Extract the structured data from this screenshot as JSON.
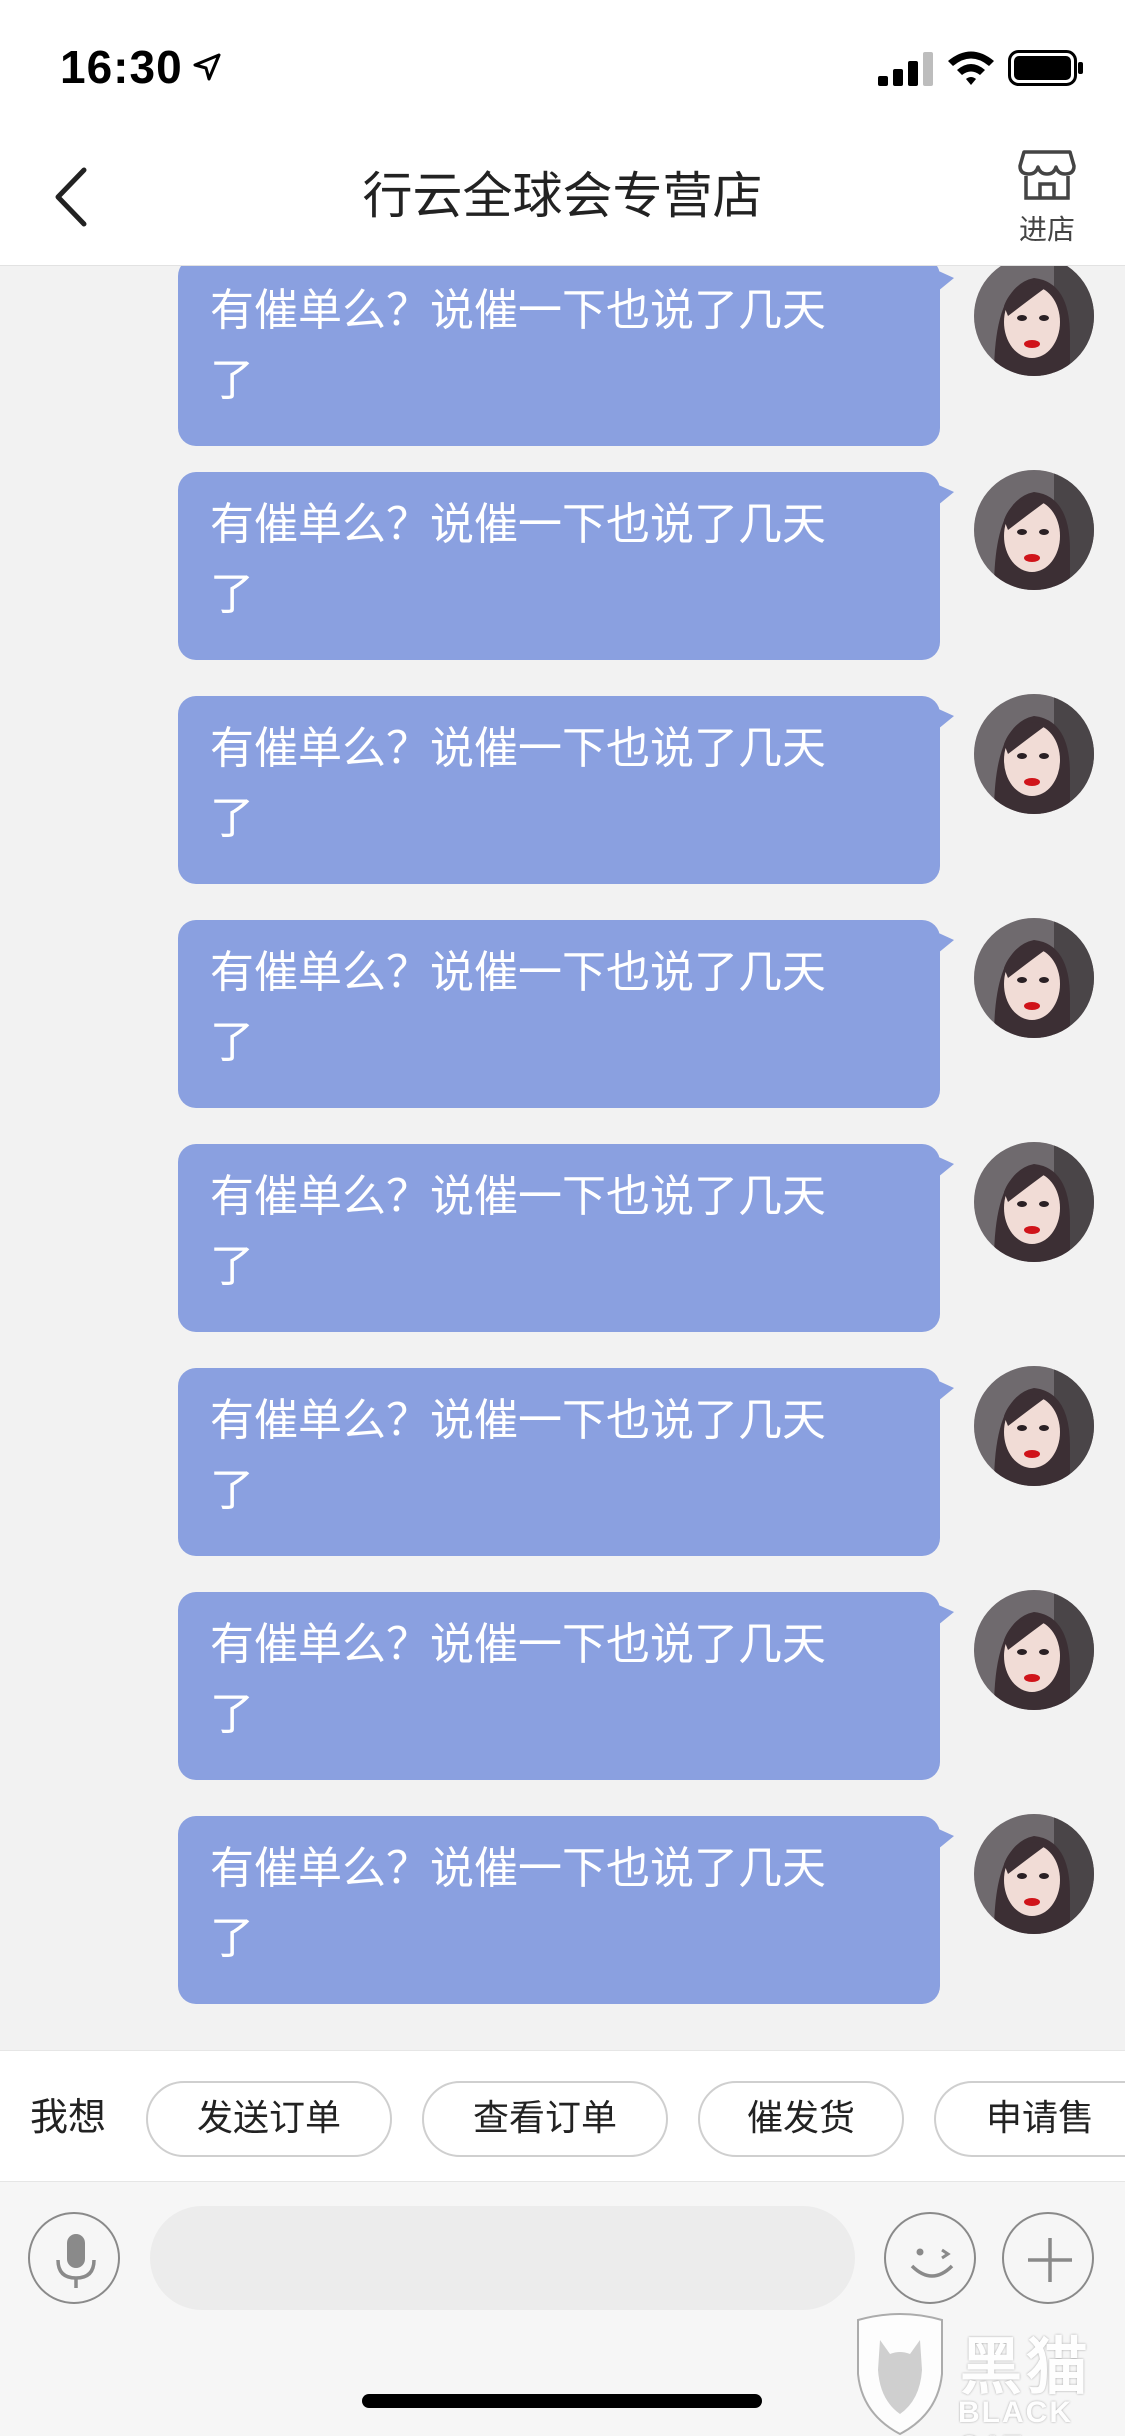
{
  "status_bar": {
    "time": "16:30",
    "icons": [
      "location-arrow-icon",
      "cellular-signal-icon",
      "wifi-icon",
      "battery-icon"
    ]
  },
  "nav": {
    "back_icon": "chevron-left-icon",
    "title": "行云全球会专营店",
    "store_icon": "storefront-icon",
    "store_label": "进店"
  },
  "messages": [
    {
      "line1": "有催单么？说催一下也说了几天",
      "line2": "了"
    },
    {
      "line1": "有催单么？说催一下也说了几天",
      "line2": "了"
    },
    {
      "line1": "有催单么？说催一下也说了几天",
      "line2": "了"
    },
    {
      "line1": "有催单么？说催一下也说了几天",
      "line2": "了"
    },
    {
      "line1": "有催单么？说催一下也说了几天",
      "line2": "了"
    },
    {
      "line1": "有催单么？说催一下也说了几天",
      "line2": "了"
    },
    {
      "line1": "有催单么？说催一下也说了几天",
      "line2": "了"
    },
    {
      "line1": "有催单么？说催一下也说了几天",
      "line2": "了"
    }
  ],
  "quick_actions": {
    "label": "我想",
    "chips": [
      "发送订单",
      "查看订单",
      "催发货",
      "申请售"
    ]
  },
  "input_bar": {
    "voice_icon": "microphone-icon",
    "placeholder": "",
    "emoji_icon": "smiley-icon",
    "plus_icon": "plus-icon"
  },
  "watermark": {
    "cn": "黑猫",
    "en": "BLACK CAT"
  },
  "colors": {
    "bubble": "#8aa0e0",
    "chat_bg": "#f2f2f2",
    "bar_bg": "#ffffff"
  }
}
